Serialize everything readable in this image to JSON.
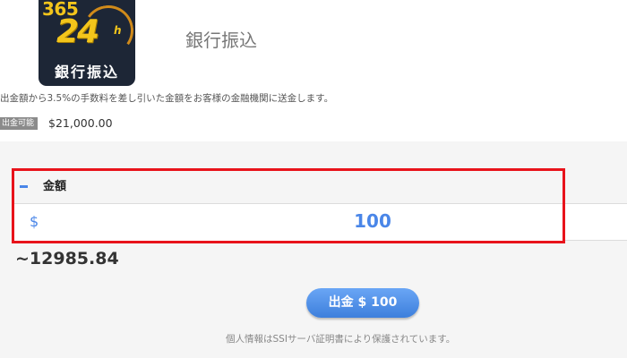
{
  "logo": {
    "top_text": "365",
    "main_text": "24",
    "suffix_text": "h",
    "caption": "銀行振込",
    "colors": {
      "background": "#1d2636",
      "gold": "#f3c51b",
      "caption": "#ffffff"
    }
  },
  "page": {
    "title": "銀行振込",
    "description": "出金額から3.5%の手数料を差し引いた金額をお客様の金融機関に送金します。"
  },
  "balance": {
    "badge_label": "出金可能",
    "amount": "$21,000.00"
  },
  "form": {
    "amount_label": "金額",
    "currency_symbol": "$",
    "amount_value": "100",
    "converted_amount": "~12985.84",
    "submit_label": "出金 $ 100",
    "highlight_color": "#e8131b",
    "accent_color": "#4a86e8"
  },
  "footer": {
    "ssl_notice": "個人情報はSSIサーバ証明書により保護されています。"
  },
  "icons": {
    "amount_header": "minus-icon"
  }
}
